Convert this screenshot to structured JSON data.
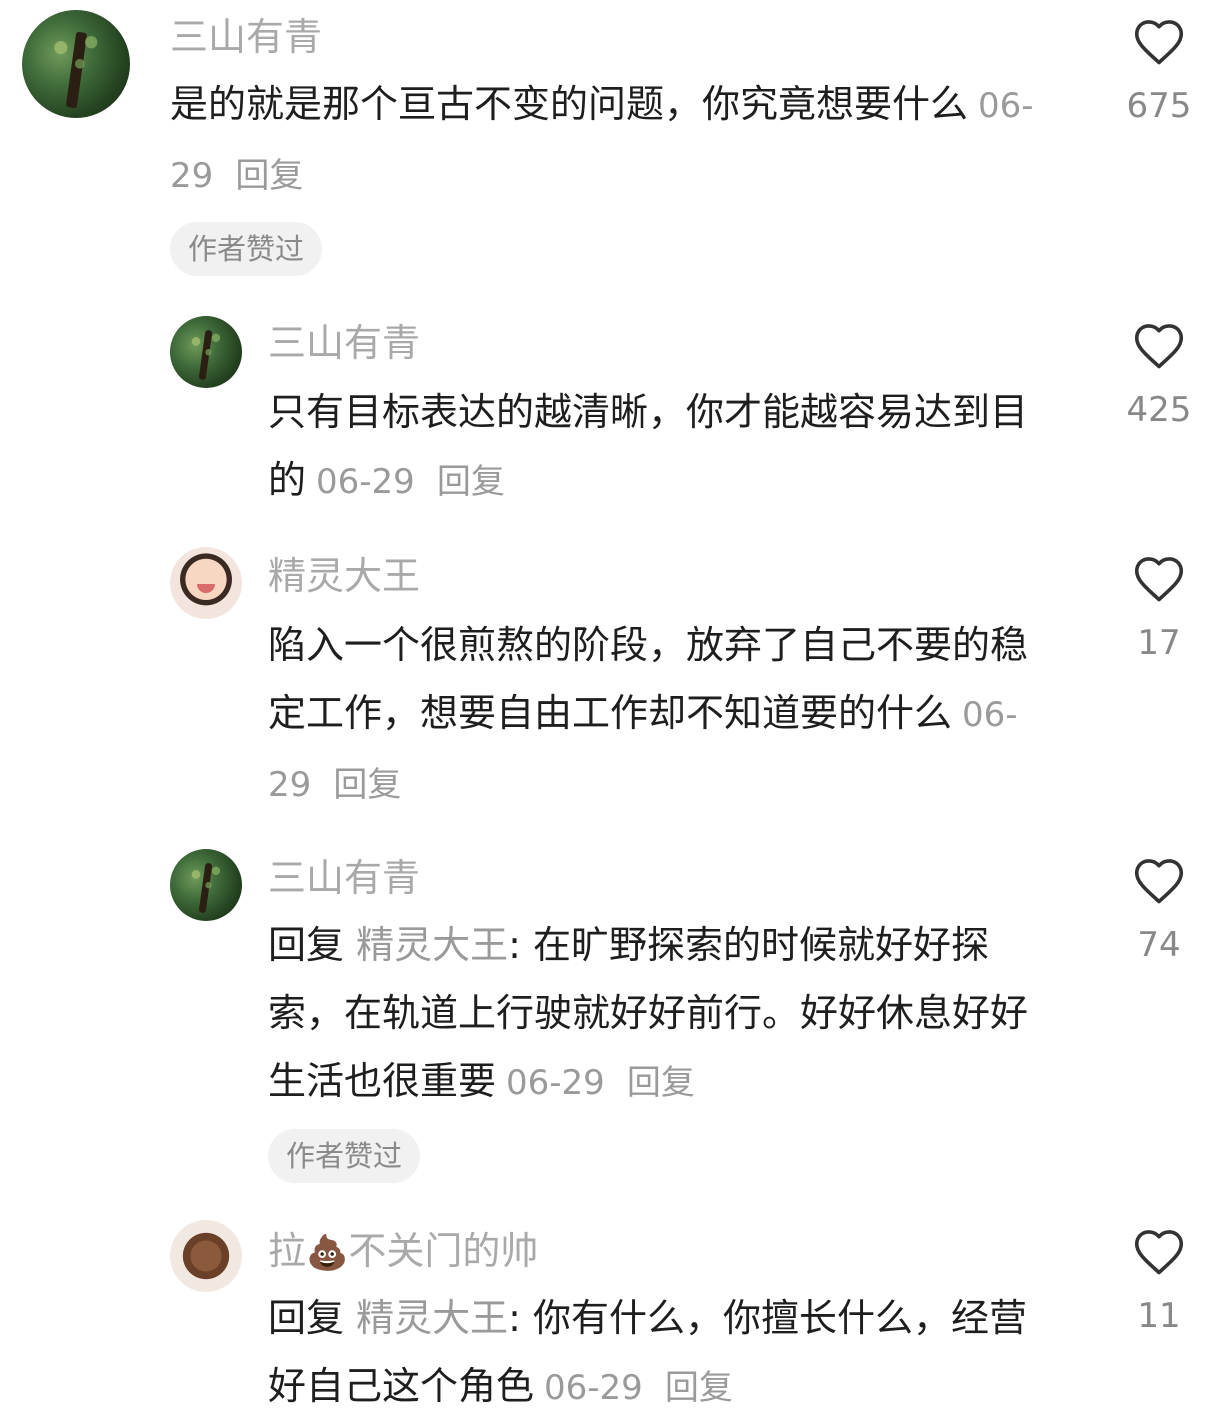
{
  "comments": [
    {
      "username": "三山有青",
      "text": "是的就是那个亘古不变的问题，你究竟想要什么",
      "date": "06-29",
      "reply_label": "回复",
      "badge": "作者赞过",
      "likes": "675",
      "avatar_icon": "tree-avatar-icon"
    },
    {
      "username": "三山有青",
      "text": "只有目标表达的越清晰，你才能越容易达到目的",
      "date": "06-29",
      "reply_label": "回复",
      "likes": "425",
      "avatar_icon": "tree-avatar-icon"
    },
    {
      "username": "精灵大王",
      "text": "陷入一个很煎熬的阶段，放弃了自己不要的稳定工作，想要自由工作却不知道要的什么",
      "date": "06-29",
      "reply_label": "回复",
      "likes": "17",
      "avatar_icon": "baby-avatar-icon"
    },
    {
      "username": "三山有青",
      "reply_prefix": "回复",
      "reply_to": "精灵大王",
      "text": ": 在旷野探索的时候就好好探索，在轨道上行驶就好好前行。好好休息好好生活也很重要",
      "date": "06-29",
      "reply_label": "回复",
      "badge": "作者赞过",
      "likes": "74",
      "avatar_icon": "tree-avatar-icon"
    },
    {
      "username_prefix": "拉",
      "username_emoji": "💩",
      "username_suffix": "不关门的帅",
      "reply_prefix": "回复",
      "reply_to": "精灵大王",
      "text": ": 你有什么，你擅长什么，经营好自己这个角色",
      "date": "06-29",
      "reply_label": "回复",
      "likes": "11",
      "avatar_icon": "poop-avatar-icon"
    }
  ],
  "colors": {
    "username": "#a9a9a9",
    "text": "#1e1e1e",
    "meta": "#9a9a9a",
    "badge_bg": "#f1f1f1"
  },
  "icons": {
    "like": "heart-outline-icon"
  }
}
